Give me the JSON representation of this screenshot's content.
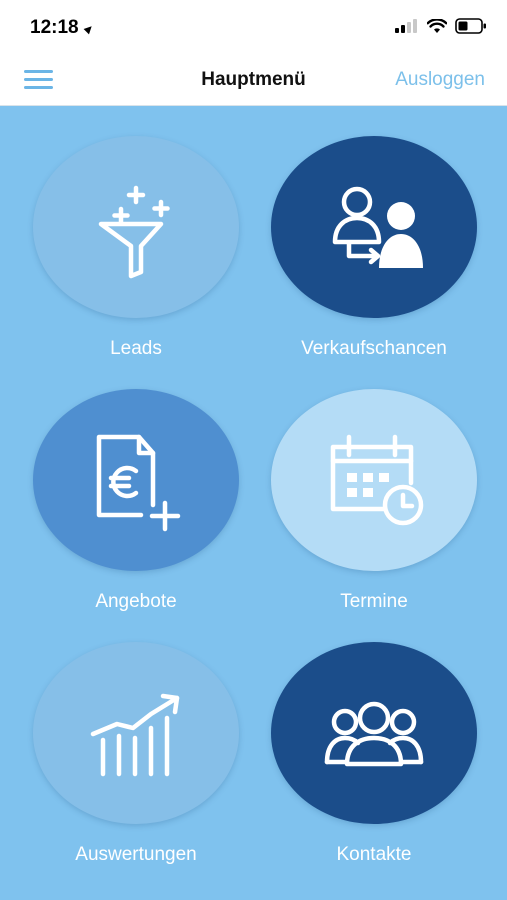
{
  "status": {
    "time": "12:18"
  },
  "nav": {
    "title": "Hauptmenü",
    "logout_label": "Ausloggen"
  },
  "tiles": [
    {
      "label": "Leads",
      "icon": "funnel-plus-icon",
      "color": "#86bfe8"
    },
    {
      "label": "Verkaufschancen",
      "icon": "user-transfer-icon",
      "color": "#1b4d8a"
    },
    {
      "label": "Angebote",
      "icon": "euro-document-add-icon",
      "color": "#4f8fd0"
    },
    {
      "label": "Termine",
      "icon": "calendar-clock-icon",
      "color": "#b4dcf6"
    },
    {
      "label": "Auswertungen",
      "icon": "bar-chart-trend-icon",
      "color": "#86bfe8"
    },
    {
      "label": "Kontakte",
      "icon": "contacts-group-icon",
      "color": "#1b4d8a"
    }
  ]
}
